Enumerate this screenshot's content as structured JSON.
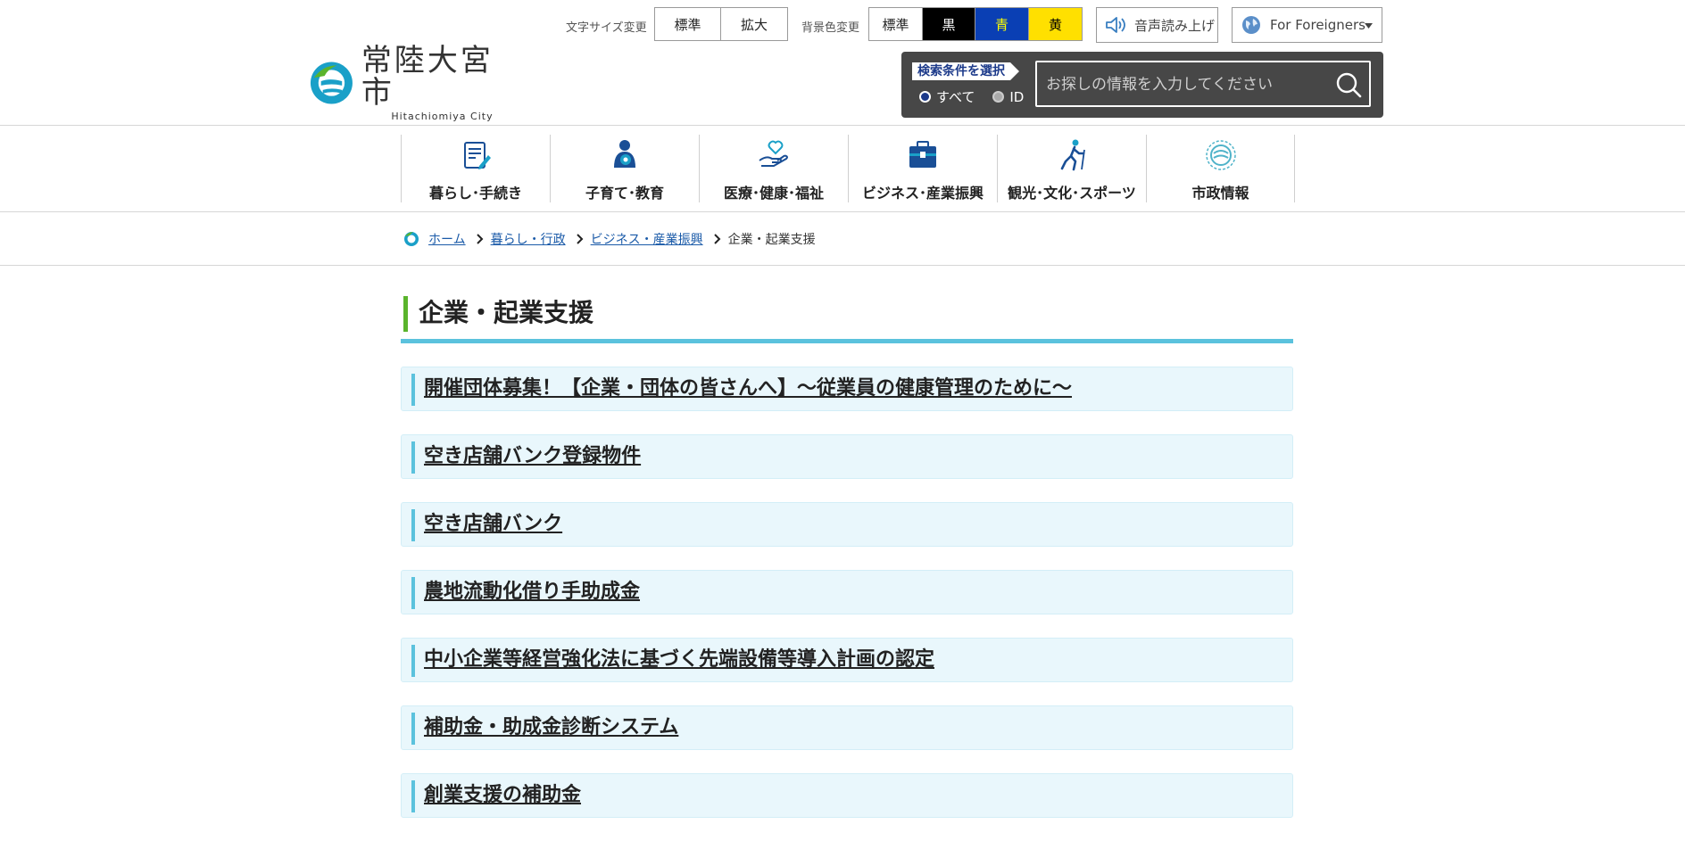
{
  "utility": {
    "font_size_label": "文字サイズ変更",
    "font_size_options": [
      "標準",
      "拡大"
    ],
    "bg_color_label": "背景色変更",
    "bg_color_options": [
      {
        "label": "標準",
        "bg": "#ffffff",
        "fg": "#222222"
      },
      {
        "label": "黒",
        "bg": "#000000",
        "fg": "#ffffff"
      },
      {
        "label": "青",
        "bg": "#0a3fb4",
        "fg": "#ffff00"
      },
      {
        "label": "黄",
        "bg": "#ffe000",
        "fg": "#000000"
      }
    ],
    "voice_label": "音声読み上げ",
    "foreigners_label": "For Foreigners"
  },
  "logo": {
    "jp": "常陸大宮市",
    "en": "Hitachiomiya City"
  },
  "search": {
    "condition_label": "検索条件を選択",
    "radio_all": "すべて",
    "radio_id": "ID",
    "placeholder": "お探しの情報を入力してください"
  },
  "nav": [
    {
      "label": "暮らし･手続き",
      "icon": "document-pen-icon"
    },
    {
      "label": "子育て･教育",
      "icon": "parent-child-icon"
    },
    {
      "label": "医療･健康･福祉",
      "icon": "hand-heart-icon"
    },
    {
      "label": "ビジネス･産業振興",
      "icon": "briefcase-icon"
    },
    {
      "label": "観光･文化･スポーツ",
      "icon": "hiker-icon"
    },
    {
      "label": "市政情報",
      "icon": "city-emblem-icon"
    }
  ],
  "breadcrumb": {
    "home": "ホーム",
    "items": [
      "暮らし・行政",
      "ビジネス・産業振興"
    ],
    "current": "企業・起業支援"
  },
  "page_title": "企業・起業支援",
  "links": [
    "開催団体募集！【企業・団体の皆さんへ】～従業員の健康管理のために～",
    "空き店舗バンク登録物件",
    "空き店舗バンク",
    "農地流動化借り手助成金",
    "中小企業等経営強化法に基づく先端設備等導入計画の認定",
    "補助金・助成金診断システム",
    "創業支援の補助金"
  ],
  "colors": {
    "accent_green": "#5ab42c",
    "accent_blue": "#5bc2dd",
    "link_blue": "#1a5aa8",
    "search_bg": "#474747"
  }
}
